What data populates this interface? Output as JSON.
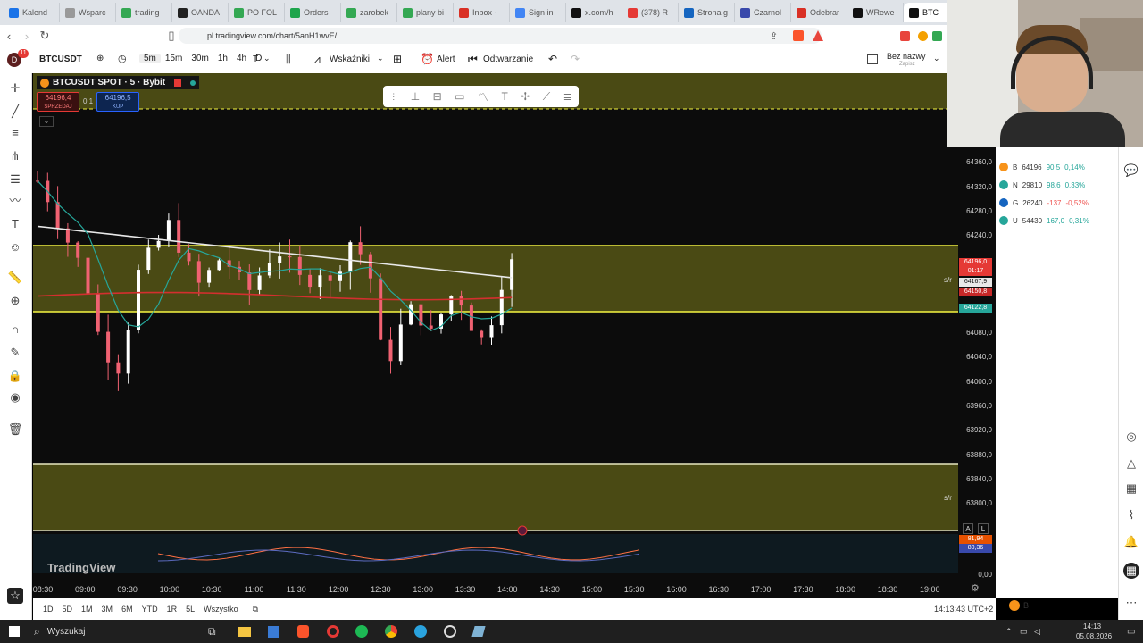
{
  "browser": {
    "tabs": [
      {
        "label": "Kalend",
        "color": "#1a73e8"
      },
      {
        "label": "Wsparc",
        "color": "#999999"
      },
      {
        "label": "trading",
        "color": "#34a853"
      },
      {
        "label": "OANDA",
        "color": "#222222"
      },
      {
        "label": "PO FOL",
        "color": "#34a853"
      },
      {
        "label": "Orders",
        "color": "#1ea54c"
      },
      {
        "label": "zarobek",
        "color": "#34a853"
      },
      {
        "label": "plany bi",
        "color": "#34a853"
      },
      {
        "label": "Inbox -",
        "color": "#d93025"
      },
      {
        "label": "Sign in",
        "color": "#4285f4"
      },
      {
        "label": "x.com/h",
        "color": "#111111"
      },
      {
        "label": "(378) R",
        "color": "#e53935"
      },
      {
        "label": "Strona g",
        "color": "#1565c0"
      },
      {
        "label": "Czarnol",
        "color": "#3949ab"
      },
      {
        "label": "Odebrar",
        "color": "#d93025"
      },
      {
        "label": "WRewe",
        "color": "#111111"
      },
      {
        "label": "BTC",
        "color": "#111111"
      }
    ],
    "url": "pl.tradingview.com/chart/5anH1wvE/"
  },
  "toolbar": {
    "avatar": "D",
    "notif_count": "11",
    "symbol": "BTCUSDT",
    "intervals": [
      "5m",
      "15m",
      "30m",
      "1h",
      "4h",
      "D"
    ],
    "interval_t": "T",
    "indicators_label": "Wskaźniki",
    "alert_label": "Alert",
    "replay_label": "Odtwarzanie",
    "layout_name": "Bez nazwy",
    "layout_sub": "Zapisz"
  },
  "chart": {
    "title": "BTCUSDT SPOT · 5 · Bybit",
    "sell_price": "64196,4",
    "sell_label": "SPRZEDAJ",
    "spread": "0,1",
    "buy_price": "64196,5",
    "buy_label": "KUP",
    "sr_label_1": "s/r",
    "sr_label_2": "s/r",
    "watermark": "TradingView",
    "scale_a": "A",
    "scale_l": "L"
  },
  "price_axis": {
    "ticks": [
      "64360,0",
      "64320,0",
      "64280,0",
      "64240,0",
      "64080,0",
      "64040,0",
      "64000,0",
      "63960,0",
      "63920,0",
      "63880,0",
      "63840,0",
      "63800,0"
    ],
    "last_price": "64196,0",
    "countdown": "01:17",
    "ma_white": "64167,9",
    "ma_red": "64150,8",
    "ma_teal": "64122,8",
    "osc_1": "81,94",
    "osc_2": "80,36",
    "osc_zero": "0,00"
  },
  "time_axis": [
    "08:30",
    "09:00",
    "09:30",
    "10:00",
    "10:30",
    "11:00",
    "11:30",
    "12:00",
    "12:30",
    "13:00",
    "13:30",
    "14:00",
    "14:30",
    "15:00",
    "15:30",
    "16:00",
    "16:30",
    "17:00",
    "17:30",
    "18:00",
    "18:30",
    "19:00"
  ],
  "bottom": {
    "ranges": [
      "1D",
      "5D",
      "1M",
      "3M",
      "6M",
      "YTD",
      "1R",
      "5L",
      "Wszystko"
    ],
    "clock": "14:13:43 UTC+2"
  },
  "watchlist": [
    {
      "sym": "B",
      "last": "64196",
      "chg": "90,5",
      "pct": "0,14%",
      "color": "#f7931a",
      "chgColor": "#26a69a"
    },
    {
      "sym": "N",
      "last": "29810",
      "chg": "98,6",
      "pct": "0,33%",
      "color": "#26a69a",
      "chgColor": "#26a69a"
    },
    {
      "sym": "G",
      "last": "26240",
      "chg": "-137",
      "pct": "-0,52%",
      "color": "#1565c0",
      "chgColor": "#ef5350"
    },
    {
      "sym": "U",
      "last": "54430",
      "chg": "167,0",
      "pct": "0,31%",
      "color": "#26a69a",
      "chgColor": "#26a69a"
    }
  ],
  "taskbar": {
    "search": "Wyszukaj",
    "time": "14:13",
    "date": "05.08.2026"
  },
  "right_panel_symbol": "B",
  "colors": {
    "zone_fill": "#4a4a14",
    "zone_line": "#f5f542",
    "up_candle": "#ffffff",
    "down_candle": "#f06272",
    "ma_white": "#e8e8e8",
    "ma_red": "#d32f2f",
    "ma_teal": "#26a69a"
  }
}
